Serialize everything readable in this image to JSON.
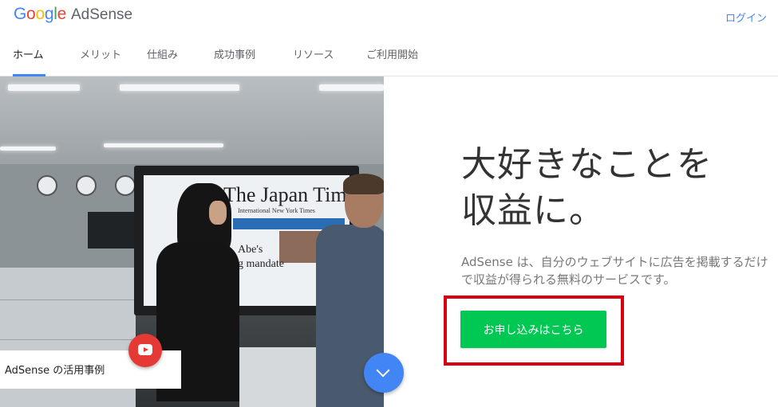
{
  "header": {
    "logo": {
      "google_letters": [
        {
          "char": "G",
          "color": "#4285F4"
        },
        {
          "char": "o",
          "color": "#EA4335"
        },
        {
          "char": "o",
          "color": "#FBBC05"
        },
        {
          "char": "g",
          "color": "#4285F4"
        },
        {
          "char": "l",
          "color": "#34A853"
        },
        {
          "char": "e",
          "color": "#EA4335"
        }
      ],
      "product": "AdSense"
    },
    "login_label": "ログイン"
  },
  "nav": {
    "items": [
      {
        "label": "ホーム",
        "active": true
      },
      {
        "label": "メリット",
        "active": false
      },
      {
        "label": "仕組み",
        "active": false
      },
      {
        "label": "成功事例",
        "active": false
      },
      {
        "label": "リソース",
        "active": false
      },
      {
        "label": "ご利用開始",
        "active": false
      }
    ],
    "active_color": "#4285F4"
  },
  "hero": {
    "video_caption": "AdSense の活用事例",
    "newspaper": {
      "title": "The Japan Times",
      "subtitle": "International New York Times",
      "headline_1": "Abe's",
      "headline_2": "g mandate"
    },
    "headline_lines": [
      "大好きなことを",
      "収益に。"
    ],
    "description": "AdSense は、自分のウェブサイトに広告を掲載するだけで収益が得られる無料のサービスです。",
    "cta_label": "お申し込みはこちら",
    "cta_color": "#00C853",
    "highlight_color": "#D9000F"
  },
  "icons": {
    "youtube": "youtube-play-icon",
    "scroll": "chevron-down-icon"
  }
}
